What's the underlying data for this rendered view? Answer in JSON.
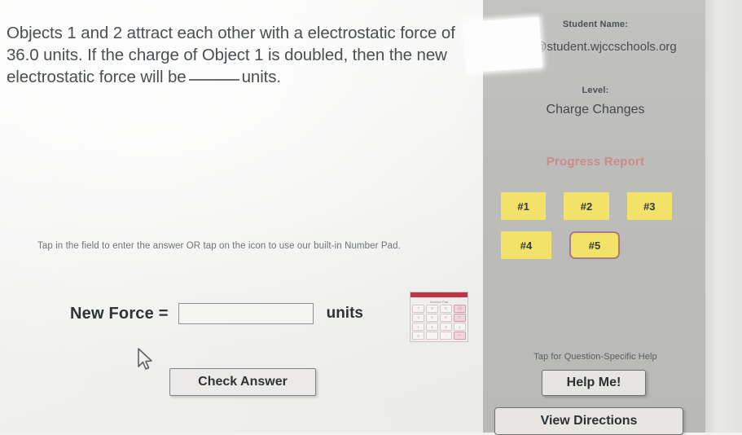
{
  "question": {
    "part1": "Objects 1 and 2 attract each other with a electrostatic force of 36.0 units. If the charge of Object 1 is doubled, then the new electrostatic force will be",
    "part2": "units."
  },
  "hint": {
    "tap_text": "Tap in the field to enter the answer OR tap on the icon to use our built-in Number Pad."
  },
  "answer": {
    "label": "New Force =",
    "value": "",
    "placeholder": "",
    "units": "units"
  },
  "numpad": {
    "icon_name": "number-pad-icon",
    "title": "Number Pad",
    "keys": [
      "7",
      "8",
      "9",
      "⌫",
      "4",
      "5",
      "6",
      "C",
      "1",
      "2",
      "3",
      "x",
      "0",
      ".",
      "-",
      "↵"
    ]
  },
  "buttons": {
    "check_answer": "Check Answer"
  },
  "sidebar": {
    "student_name_label": "Student Name:",
    "student_email": "806@student.wjccschools.org",
    "level_label": "Level:",
    "level_value": "Charge Changes",
    "progress_title": "Progress Report",
    "progress_items": [
      {
        "label": "#1",
        "current": false
      },
      {
        "label": "#2",
        "current": false
      },
      {
        "label": "#3",
        "current": false
      },
      {
        "label": "#4",
        "current": false
      },
      {
        "label": "#5",
        "current": true
      }
    ],
    "help_hint": "Tap for Question-Specific Help",
    "help_me": "Help Me!",
    "view_directions": "View Directions"
  },
  "colors": {
    "panel_bg": "#bcbcba",
    "progress_tile": "#f2e26a",
    "progress_title": "#cc8a8a",
    "current_border": "#a87b84",
    "numpad_accent": "#c0344a"
  }
}
